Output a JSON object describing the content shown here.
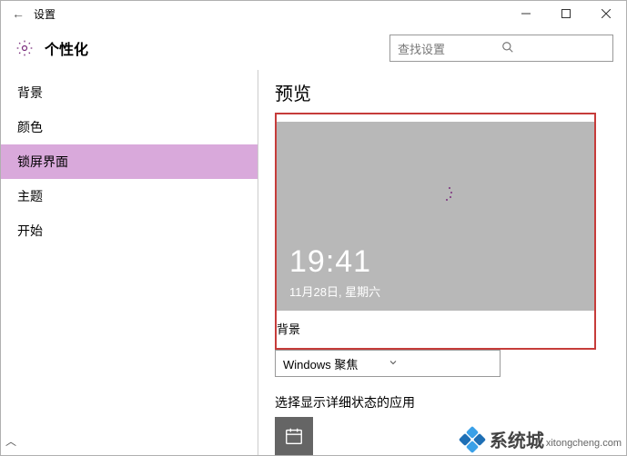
{
  "titlebar": {
    "title": "设置"
  },
  "header": {
    "page_title": "个性化"
  },
  "search": {
    "placeholder": "查找设置"
  },
  "sidebar": {
    "items": [
      {
        "label": "背景"
      },
      {
        "label": "颜色"
      },
      {
        "label": "锁屏界面"
      },
      {
        "label": "主题"
      },
      {
        "label": "开始"
      }
    ]
  },
  "content": {
    "preview_title": "预览",
    "clock": "19:41",
    "date": "11月28日, 星期六",
    "bg_label": "背景",
    "bg_dropdown_value": "Windows 聚焦",
    "detail_app_label": "选择显示详细状态的应用"
  },
  "watermark": {
    "brand": "系统城",
    "url": "xitongcheng.com"
  }
}
